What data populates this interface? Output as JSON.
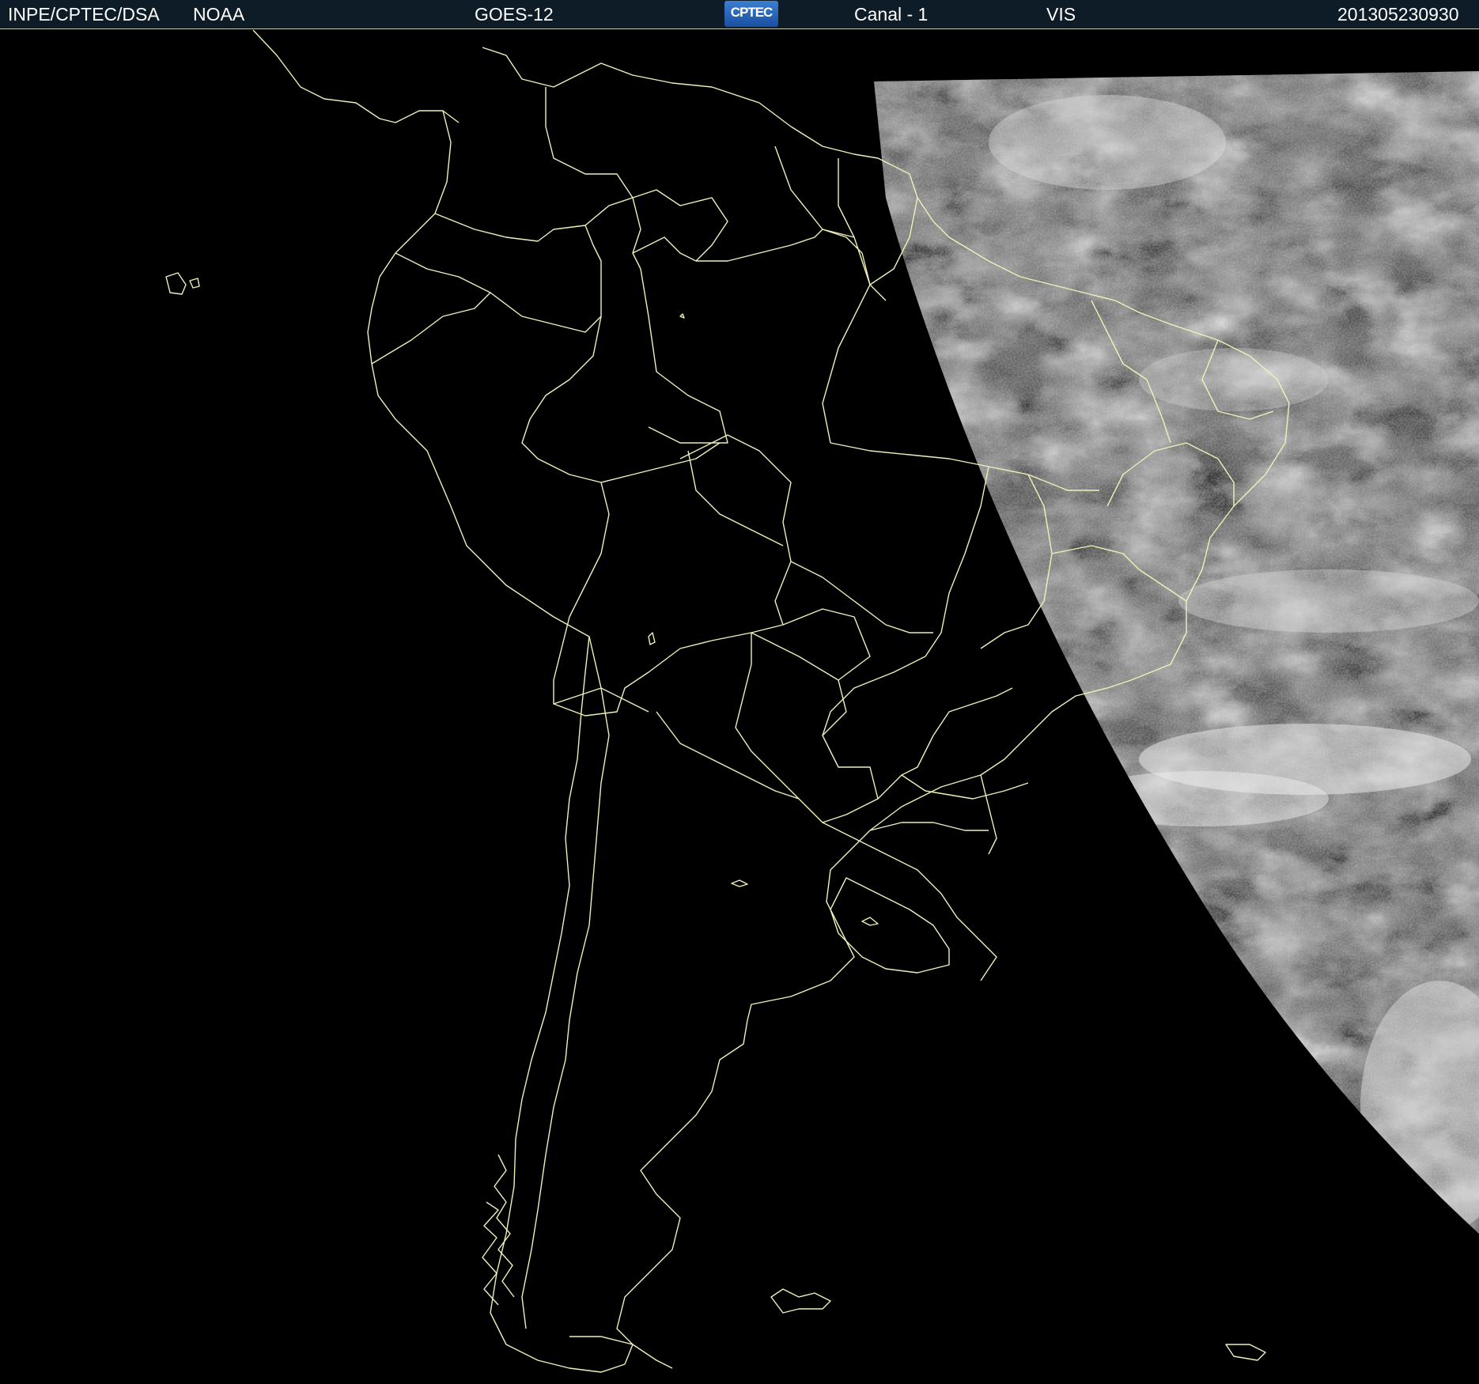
{
  "header": {
    "agency": "INPE/CPTEC/DSA",
    "source": "NOAA",
    "satellite": "GOES-12",
    "logo_text": "CPTEC",
    "channel": "Canal - 1",
    "band": "VIS",
    "timestamp": "201305230930"
  },
  "map": {
    "background_color": "#000000",
    "boundary_color": "#f0f0b8",
    "header_color": "#0d1c26",
    "region": "South America",
    "imagery": "visible satellite imagery (daylit portion on right)"
  }
}
